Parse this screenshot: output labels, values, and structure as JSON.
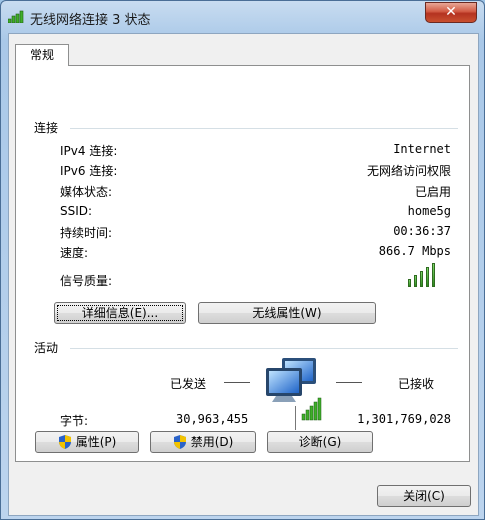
{
  "window": {
    "title": "无线网络连接 3 状态",
    "close_label": "✕"
  },
  "tabs": [
    {
      "label": "常规"
    }
  ],
  "connection": {
    "section_label": "连接",
    "rows": [
      {
        "label": "IPv4 连接:",
        "value": "Internet"
      },
      {
        "label": "IPv6 连接:",
        "value": "无网络访问权限"
      },
      {
        "label": "媒体状态:",
        "value": "已启用"
      },
      {
        "label": "SSID:",
        "value": "home5g"
      },
      {
        "label": "持续时间:",
        "value": "00:36:37"
      },
      {
        "label": "速度:",
        "value": "866.7 Mbps"
      }
    ],
    "signal_label": "信号质量:",
    "signal_bars_filled": 5,
    "signal_bars_total": 5
  },
  "buttons": {
    "details": "详细信息(E)...",
    "wireless_props": "无线属性(W)",
    "properties": "属性(P)",
    "disable": "禁用(D)",
    "diagnose": "诊断(G)",
    "close": "关闭(C)"
  },
  "activity": {
    "section_label": "活动",
    "sent_label": "已发送",
    "received_label": "已接收",
    "bytes_label": "字节:",
    "bytes_sent": "30,963,455",
    "bytes_received": "1,301,769,028"
  },
  "colors": {
    "accent": "#3a7bd5",
    "signal": "#3fae2a",
    "close": "#c9452e"
  }
}
